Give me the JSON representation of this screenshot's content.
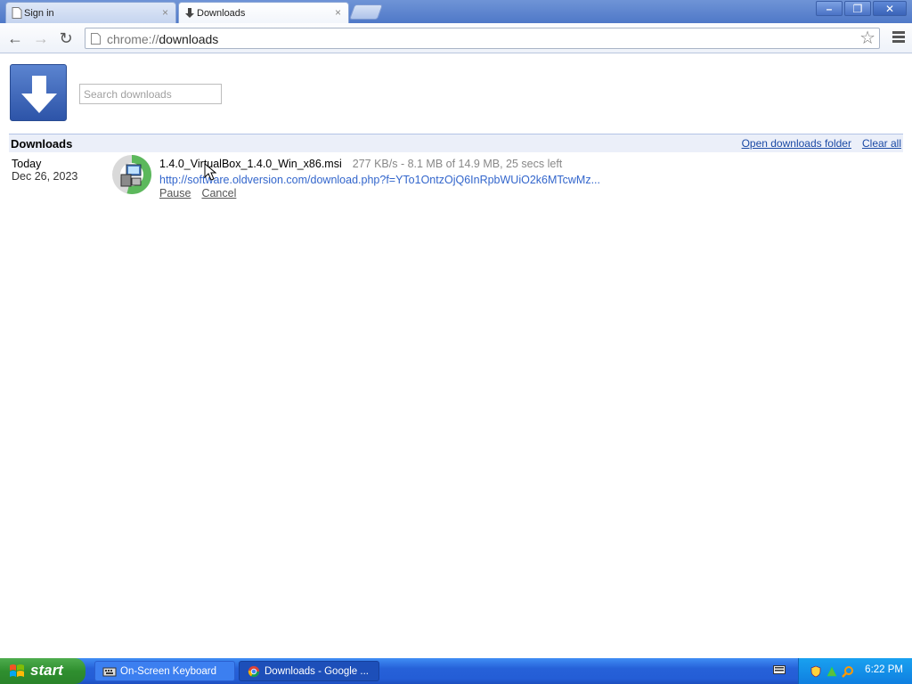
{
  "tabs": [
    {
      "label": "Sign in",
      "close": "×"
    },
    {
      "label": "Downloads",
      "close": "×"
    }
  ],
  "window_controls": {
    "minimize": "–",
    "restore": "❐",
    "close": "✕"
  },
  "toolbar": {
    "back_icon": "←",
    "forward_icon": "→",
    "reload_icon": "↻",
    "url_scheme": "chrome://",
    "url_path": "downloads",
    "star_icon": "☆"
  },
  "page": {
    "search_placeholder": "Search downloads",
    "section_title": "Downloads",
    "open_folder_link": "Open downloads folder",
    "clear_all_link": "Clear all"
  },
  "downloads": [
    {
      "date_line1": "Today",
      "date_line2": "Dec 26, 2023",
      "filename": "1.4.0_VirtualBox_1.4.0_Win_x86.msi",
      "status": "277 KB/s - 8.1 MB of 14.9 MB, 25 secs left",
      "progress": 0.54,
      "url": "http://software.oldversion.com/download.php?f=YTo1OntzOjQ6InRpbWUiO2k6MTcwMz...",
      "pause": "Pause",
      "cancel": "Cancel"
    }
  ],
  "taskbar": {
    "start": "start",
    "items": [
      {
        "label": "On-Screen Keyboard"
      },
      {
        "label": "Downloads - Google ..."
      }
    ],
    "clock": "6:22 PM"
  },
  "colors": {
    "link": "#1b4aa5",
    "url": "#3366cc",
    "taskbar": "#245dd6",
    "start": "#2f8f2f",
    "tray": "#0f7fe0"
  }
}
